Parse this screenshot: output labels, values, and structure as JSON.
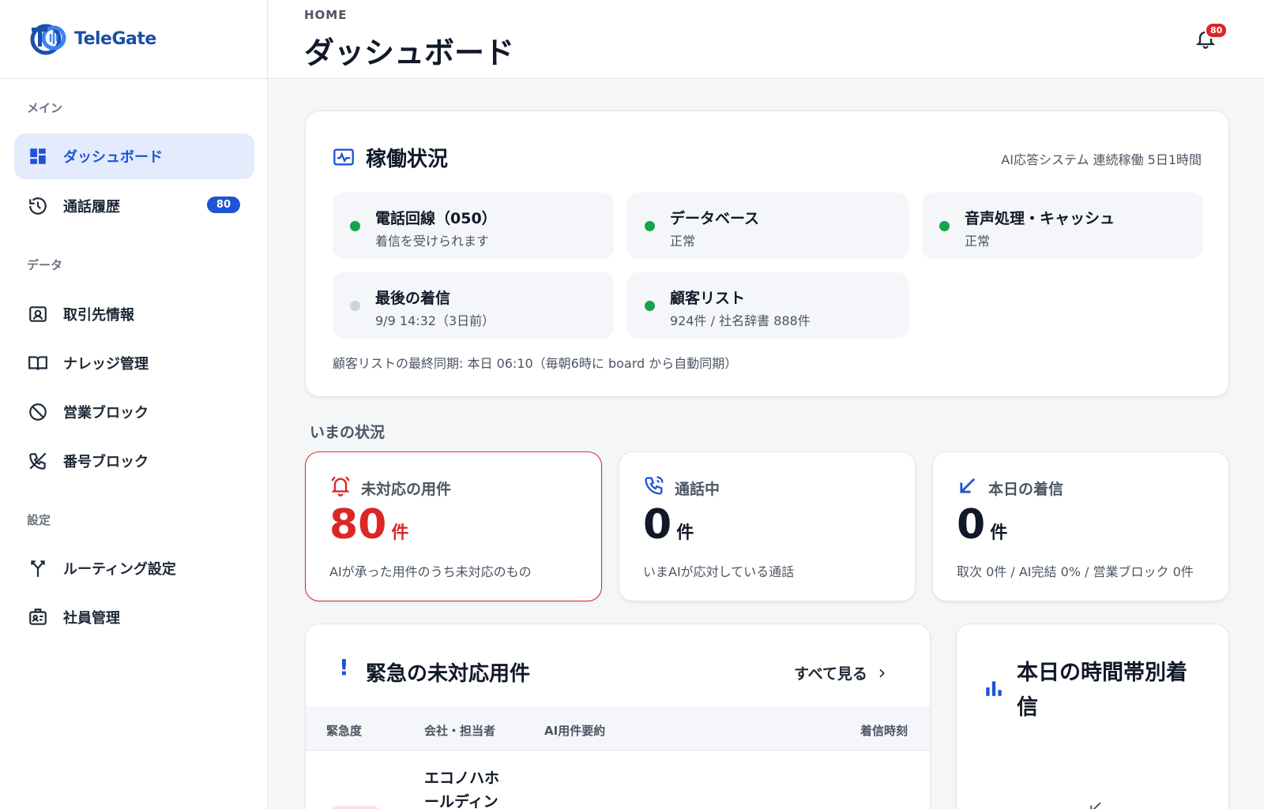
{
  "sidebar": {
    "brand": "TeleGate",
    "sections": {
      "main": "メイン",
      "data": "データ",
      "settings": "設定"
    },
    "items": [
      {
        "label": "ダッシュボード",
        "icon": "dashboard-icon",
        "active": true
      },
      {
        "label": "通話履歴",
        "icon": "history-icon",
        "badge": "80"
      },
      {
        "label": "取引先情報",
        "icon": "contact-card-icon"
      },
      {
        "label": "ナレッジ管理",
        "icon": "book-icon"
      },
      {
        "label": "営業ブロック",
        "icon": "block-icon"
      },
      {
        "label": "番号ブロック",
        "icon": "phone-off-icon"
      },
      {
        "label": "ルーティング設定",
        "icon": "routing-icon"
      },
      {
        "label": "社員管理",
        "icon": "badge-icon"
      }
    ]
  },
  "header": {
    "breadcrumb": "HOME",
    "title": "ダッシュボード",
    "notification_count": "80"
  },
  "status": {
    "title": "稼働状況",
    "uptime": "AI応答システム 連続稼働 5日1時間",
    "tiles": [
      {
        "title": "電話回線（050）",
        "sub": "着信を受けられます",
        "status_color": "#16a34a"
      },
      {
        "title": "データベース",
        "sub": "正常",
        "status_color": "#16a34a"
      },
      {
        "title": "音声処理・キャッシュ",
        "sub": "正常",
        "status_color": "#16a34a"
      },
      {
        "title": "最後の着信",
        "sub": "9/9 14:32（3日前）",
        "status_color": "#cbd5e1"
      },
      {
        "title": "顧客リスト",
        "sub": "924件 / 社名辞書 888件",
        "status_color": "#16a34a"
      }
    ],
    "sync_note": "顧客リストの最終同期: 本日 06:10（毎朝6時に board から自動同期）"
  },
  "now": {
    "label": "いまの状況",
    "metrics": [
      {
        "title": "未対応の用件",
        "value": "80",
        "unit": "件",
        "desc": "AIが承った用件のうち未対応のもの",
        "icon": "bell-alert-icon"
      },
      {
        "title": "通話中",
        "value": "0",
        "unit": "件",
        "desc": "いまAIが応対している通話",
        "icon": "phone-in-call-icon"
      },
      {
        "title": "本日の着信",
        "value": "0",
        "unit": "件",
        "desc": "取次 0件 / AI完結 0% / 営業ブロック 0件",
        "icon": "incoming-arrow-icon"
      }
    ]
  },
  "urgent": {
    "title": "緊急の未対応用件",
    "see_all": "すべて見る",
    "columns": [
      "緊急度",
      "会社・担当者",
      "AI用件要約",
      "着信時刻"
    ],
    "rows": [
      {
        "company": "エコノハホールディン"
      }
    ]
  },
  "hourly": {
    "title": "本日の時間帯別着信"
  },
  "colors": {
    "accent": "#1f54d6",
    "alert": "#dc2626",
    "ok": "#16a34a"
  }
}
